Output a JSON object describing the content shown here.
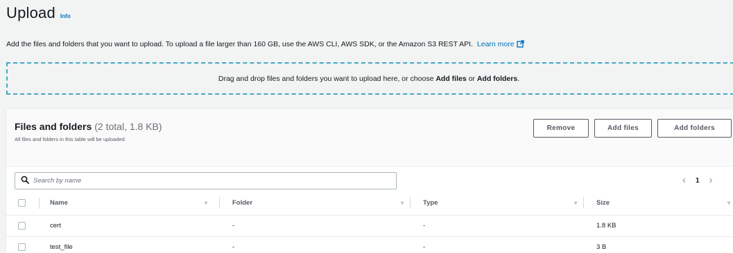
{
  "header": {
    "title": "Upload",
    "info_label": "Info"
  },
  "description": {
    "text": "Add the files and folders that you want to upload. To upload a file larger than 160 GB, use the AWS CLI, AWS SDK, or the Amazon S3 REST API.",
    "learn_more": "Learn more"
  },
  "dropzone": {
    "prefix": "Drag and drop files and folders you want to upload here, or choose ",
    "add_files": "Add files",
    "or": " or ",
    "add_folders": "Add folders",
    "suffix": "."
  },
  "files_panel": {
    "title": "Files and folders",
    "counter": "(2 total, 1.8 KB)",
    "subtitle": "All files and folders in this table will be uploaded",
    "buttons": {
      "remove": "Remove",
      "add_files": "Add files",
      "add_folders": "Add folders"
    },
    "search": {
      "placeholder": "Search by name",
      "value": ""
    },
    "pagination": {
      "prev": "‹",
      "current_page": "1",
      "next": "›"
    },
    "columns": [
      "Name",
      "Folder",
      "Type",
      "Size"
    ],
    "rows": [
      {
        "name": "cert",
        "folder": "-",
        "type": "-",
        "size": "1.8 KB"
      },
      {
        "name": "test_file",
        "folder": "-",
        "type": "-",
        "size": "3 B"
      }
    ]
  },
  "colors": {
    "link": "#0073bb",
    "dropzone_border": "#44a6c6",
    "page_background": "#f2f3f3"
  },
  "icons": {
    "learn_more": "external-link-icon",
    "search": "search-icon",
    "sort": "sort-caret-down-icon"
  }
}
